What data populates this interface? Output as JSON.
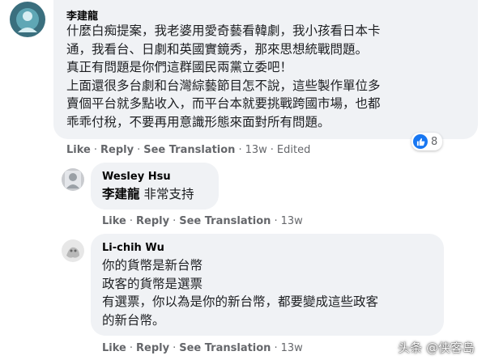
{
  "comments": [
    {
      "author": "李建龍",
      "lines": [
        "什麼白痴提案，我老婆用愛奇藝看韓劇，我小孩看日本卡",
        "通，我看台、日劇和英國實鏡秀，那來思想統戰問題。",
        "真正有問題是你們這群國民兩黨立委吧！",
        "上面還很多台劇和台灣綜藝節目怎不說，這些製作單位多",
        "賣個平台就多點收入，而平台本就要挑戰跨國市場，也都",
        "乖乖付稅，不要再用意識形態來面對所有問題。"
      ],
      "actions": {
        "like": "Like",
        "reply": "Reply",
        "see_translation": "See Translation",
        "time": "13w",
        "edited": "Edited"
      },
      "reaction_count": "8"
    },
    {
      "author": "Wesley Hsu",
      "mention": "李建龍",
      "text": "非常支持",
      "actions": {
        "like": "Like",
        "reply": "Reply",
        "see_translation": "See Translation",
        "time": "13w"
      }
    },
    {
      "author": "Li-chih Wu",
      "lines": [
        "你的貨幣是新台幣",
        "政客的貨幣是選票",
        "有選票，你以為是你的新台幣，都要變成這些政客",
        "的新台幣。"
      ],
      "actions": {
        "like": "Like",
        "reply": "Reply",
        "see_translation": "See Translation",
        "time": "13w"
      }
    }
  ],
  "watermark": "头条 @侠客岛",
  "colors": {
    "bubble": "#f0f2f5",
    "meta_text": "#65676b",
    "like_blue": "#1877f2"
  }
}
